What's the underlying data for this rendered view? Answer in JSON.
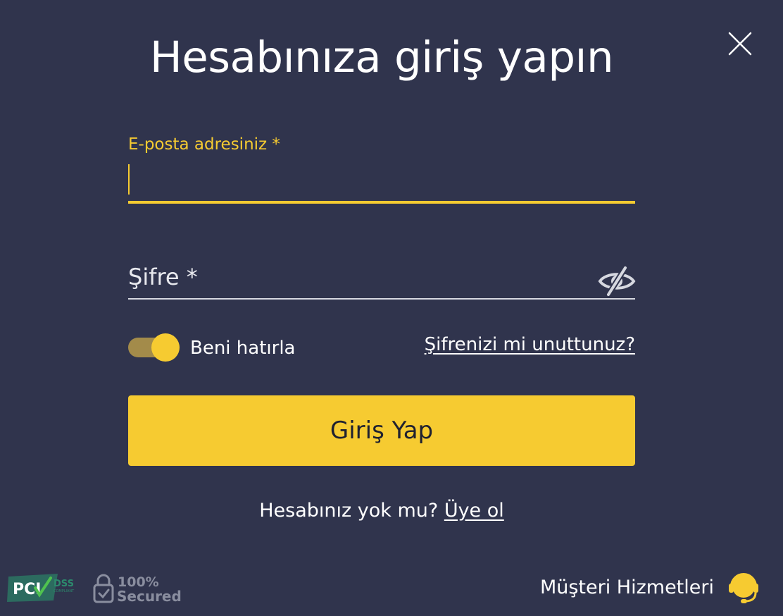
{
  "dialog": {
    "title": "Hesabınıza giriş yapın",
    "close_icon": "close-icon"
  },
  "email": {
    "label": "E-posta adresiniz *",
    "value": "",
    "focused": true
  },
  "password": {
    "label": "Şifre *",
    "value": "",
    "visibility_icon": "eye-off-icon"
  },
  "remember": {
    "label": "Beni hatırla",
    "checked": true
  },
  "forgot": {
    "label": "Şifrenizi mi unuttunuz?"
  },
  "submit": {
    "label": "Giriş Yap"
  },
  "register": {
    "prompt": "Hesabınız yok mu?",
    "link": "Üye ol"
  },
  "footer": {
    "pci_badge": {
      "text": "PCI",
      "sub": "DSS",
      "compliant": "COMPLIANT"
    },
    "secured_badge": {
      "percent": "100%",
      "text": "Secured"
    },
    "support_label": "Müşteri Hizmetleri",
    "support_icon": "headset-icon"
  },
  "colors": {
    "background": "#30344d",
    "accent": "#f6cb31",
    "toggle_track": "#a38b4a",
    "text": "#ffffff",
    "button_text": "#1f2130"
  }
}
